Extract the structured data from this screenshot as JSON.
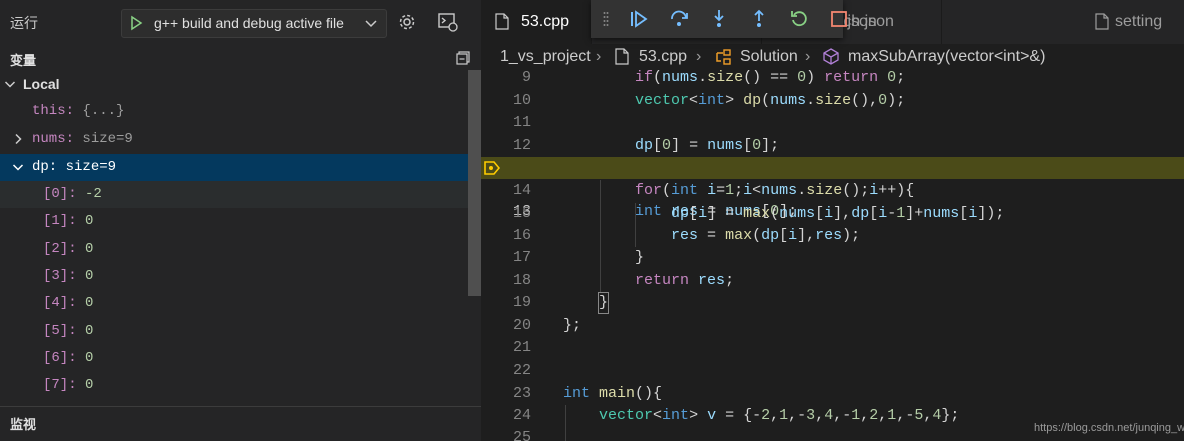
{
  "sidebar": {
    "run_title": "运行",
    "config_name": "g++ build and debug active file",
    "variables_header": "变量",
    "watch_header": "监视",
    "local_label": "Local",
    "vars": [
      {
        "name": "this:",
        "value": "{...}"
      },
      {
        "name": "nums:",
        "value": "size=9"
      },
      {
        "name": "dp:",
        "value": "size=9"
      }
    ],
    "dp_items": [
      {
        "name": "[0]:",
        "value": "-2"
      },
      {
        "name": "[1]:",
        "value": "0"
      },
      {
        "name": "[2]:",
        "value": "0"
      },
      {
        "name": "[3]:",
        "value": "0"
      },
      {
        "name": "[4]:",
        "value": "0"
      },
      {
        "name": "[5]:",
        "value": "0"
      },
      {
        "name": "[6]:",
        "value": "0"
      },
      {
        "name": "[7]:",
        "value": "0"
      }
    ]
  },
  "editor": {
    "tabs": [
      {
        "label": "53.cpp",
        "active": true
      },
      {
        "label": ".json",
        "active": false
      },
      {
        "label": "launch.json",
        "active": false
      },
      {
        "label": "setting",
        "active": false
      }
    ],
    "breadcrumb": [
      "1_vs_project",
      "53.cpp",
      "Solution",
      "maxSubArray(vector<int>&)"
    ],
    "current_line": 13,
    "line_numbers": [
      "9",
      "10",
      "11",
      "12",
      "13",
      "14",
      "15",
      "16",
      "17",
      "18",
      "19",
      "20",
      "21",
      "22",
      "23",
      "24",
      "25"
    ]
  },
  "debug_toolbar": [
    "grip-icon",
    "continue-icon",
    "step-over-icon",
    "step-into-icon",
    "step-out-icon",
    "restart-icon",
    "stop-icon"
  ],
  "watermark": "https://blog.csdn.net/junqing_wu",
  "colors": {
    "sidebar_bg": "#252526",
    "editor_bg": "#1e1e1e",
    "selection": "#04395e",
    "current_line": "#4b4b18",
    "continue": "#75beff",
    "restart": "#89d185",
    "stop": "#f48771",
    "breakpoint_arrow": "#ffcc00"
  }
}
